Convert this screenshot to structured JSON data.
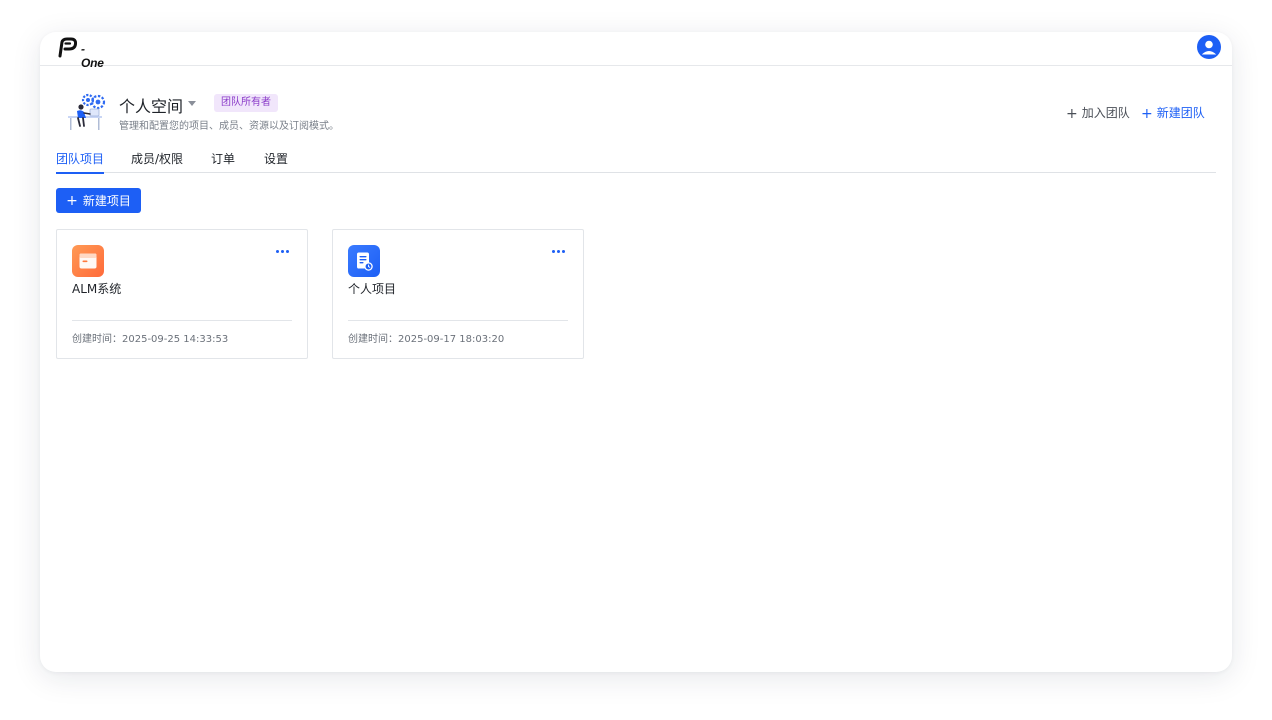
{
  "app": {
    "logo_text": "-One",
    "logo_alt": "P-One"
  },
  "space": {
    "title": "个人空间",
    "badge": "团队所有者",
    "description": "管理和配置您的项目、成员、资源以及订阅模式。"
  },
  "actions": {
    "join_team": "加入团队",
    "new_team": "新建团队"
  },
  "tabs": [
    {
      "label": "团队项目",
      "active": true
    },
    {
      "label": "成员/权限",
      "active": false
    },
    {
      "label": "订单",
      "active": false
    },
    {
      "label": "设置",
      "active": false
    }
  ],
  "toolbar": {
    "new_project_label": "新建项目"
  },
  "projects": [
    {
      "name": "ALM系统",
      "created_label": "创建时间：",
      "created_at": "2025-09-25 14:33:53",
      "icon": "archive-box-icon",
      "icon_color": "#ff7a3d"
    },
    {
      "name": "个人项目",
      "created_label": "创建时间：",
      "created_at": "2025-09-17 18:03:20",
      "icon": "document-icon",
      "icon_color": "#1d5ff5"
    }
  ],
  "colors": {
    "accent": "#1d5ff5",
    "badge_bg": "#f1e6fb",
    "badge_text": "#8a3bc9"
  }
}
